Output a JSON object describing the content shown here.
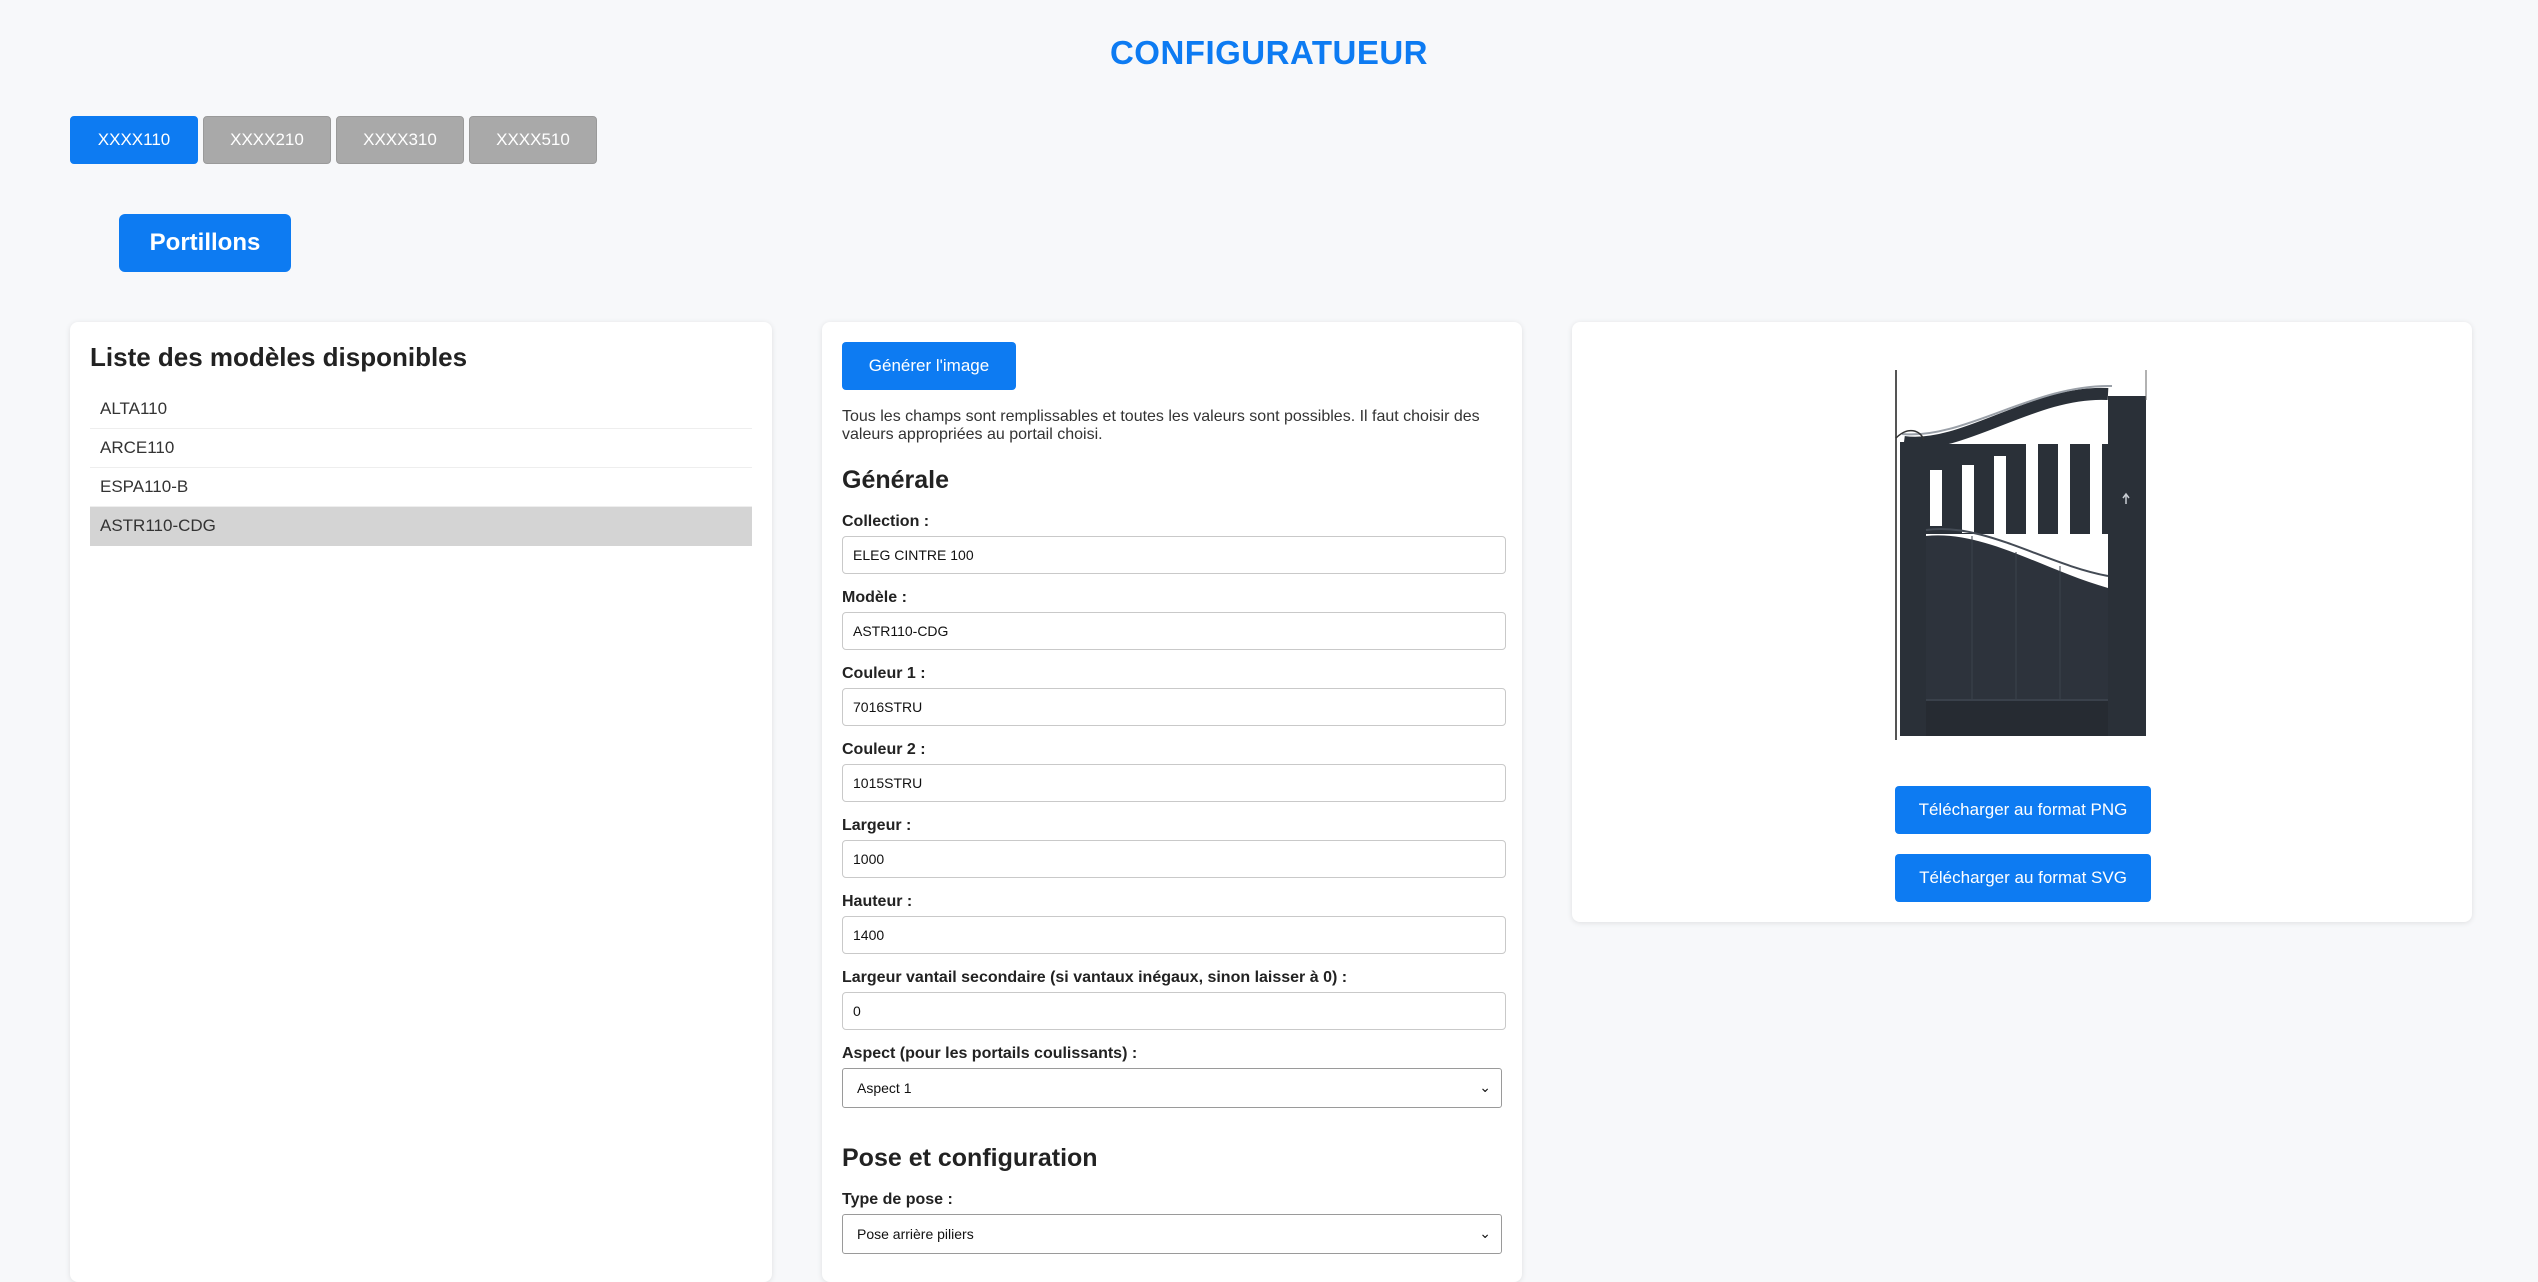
{
  "header": {
    "title": "CONFIGURATUEUR"
  },
  "top_tabs": [
    {
      "label": "XXXX110",
      "active": true
    },
    {
      "label": "XXXX210",
      "active": false
    },
    {
      "label": "XXXX310",
      "active": false
    },
    {
      "label": "XXXX510",
      "active": false
    }
  ],
  "category": {
    "label": "Portillons"
  },
  "models": {
    "title": "Liste des modèles disponibles",
    "items": [
      "ALTA110",
      "ARCE110",
      "ESPA110-B",
      "ASTR110-CDG"
    ],
    "selected": "ASTR110-CDG"
  },
  "form": {
    "generate_label": "Générer l'image",
    "info": "Tous les champs sont remplissables et toutes les valeurs sont possibles. Il faut choisir des valeurs appropriées au portail choisi.",
    "general_title": "Générale",
    "fields": {
      "collection": {
        "label": "Collection :",
        "value": "ELEG CINTRE 100"
      },
      "modele": {
        "label": "Modèle :",
        "value": "ASTR110-CDG"
      },
      "couleur1": {
        "label": "Couleur 1 :",
        "value": "7016STRU"
      },
      "couleur2": {
        "label": "Couleur 2 :",
        "value": "1015STRU"
      },
      "largeur": {
        "label": "Largeur :",
        "value": "1000"
      },
      "hauteur": {
        "label": "Hauteur :",
        "value": "1400"
      },
      "largeur_secondaire": {
        "label": "Largeur vantail secondaire (si vantaux inégaux, sinon laisser à 0) :",
        "value": "0"
      },
      "aspect": {
        "label": "Aspect (pour les portails coulissants) :",
        "value": "Aspect 1"
      }
    },
    "pose_title": "Pose et configuration",
    "type_pose": {
      "label": "Type de pose :",
      "value": "Pose arrière piliers"
    }
  },
  "preview": {
    "download_png": "Télécharger au format PNG",
    "download_svg": "Télécharger au format SVG",
    "gate_color": "#2a3038"
  },
  "colors": {
    "accent": "#0d7bf2",
    "tab_inactive": "#a9a9a9",
    "selected_row": "#d4d4d4"
  }
}
